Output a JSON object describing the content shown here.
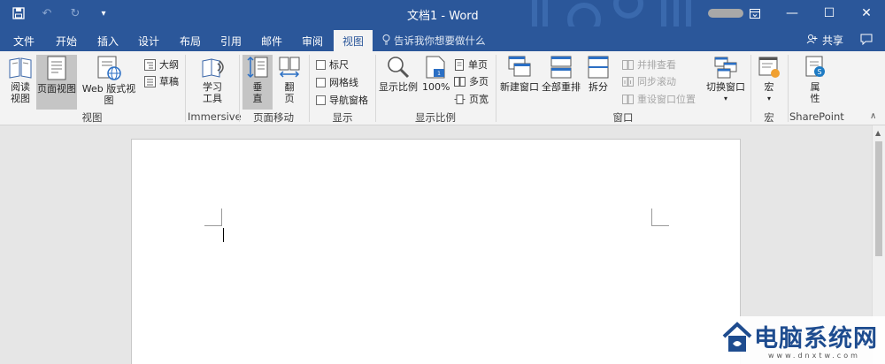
{
  "titlebar": {
    "title": "文档1 - Word",
    "qat": {
      "save_icon": "save-icon",
      "undo_icon": "undo-icon",
      "redo_icon": "redo-icon",
      "customize_icon": "customize-qat-icon"
    },
    "window_controls": [
      "ribbon-display-icon",
      "minimize-icon",
      "restore-icon",
      "close-icon"
    ]
  },
  "tabs": [
    {
      "label": "文件"
    },
    {
      "label": "开始"
    },
    {
      "label": "插入"
    },
    {
      "label": "设计"
    },
    {
      "label": "布局"
    },
    {
      "label": "引用"
    },
    {
      "label": "邮件"
    },
    {
      "label": "审阅"
    },
    {
      "label": "视图",
      "active": true
    }
  ],
  "tellme": {
    "placeholder": "告诉我你想要做什么"
  },
  "share": {
    "label": "共享"
  },
  "ribbon": {
    "views": {
      "label": "视图",
      "read_mode": "阅读\n视图",
      "read_mode_l1": "阅读",
      "read_mode_l2": "视图",
      "print_layout": "页面视图",
      "web_layout": "Web 版式视图",
      "outline": "大纲",
      "draft": "草稿"
    },
    "immersive": {
      "label": "Immersive",
      "learning_tools_l1": "学习",
      "learning_tools_l2": "工具"
    },
    "page_movement": {
      "label": "页面移动",
      "vertical_l1": "垂",
      "vertical_l2": "直",
      "side_l1": "翻",
      "side_l2": "页"
    },
    "show": {
      "label": "显示",
      "ruler": "标尺",
      "gridlines": "网格线",
      "nav_pane": "导航窗格"
    },
    "zoom": {
      "label": "显示比例",
      "zoom": "显示比例",
      "hundred": "100%",
      "one_page": "单页",
      "multi_page": "多页",
      "page_width": "页宽"
    },
    "window": {
      "label": "窗口",
      "new_window": "新建窗口",
      "arrange_all": "全部重排",
      "split": "拆分",
      "side_by_side": "并排查看",
      "sync_scroll": "同步滚动",
      "reset_position": "重设窗口位置",
      "switch_windows": "切换窗口"
    },
    "macros": {
      "label": "宏",
      "macros": "宏"
    },
    "sharepoint": {
      "label": "SharePoint",
      "properties_l1": "属",
      "properties_l2": "性"
    }
  },
  "watermark": {
    "text": "电脑系统网",
    "url": "www.dnxtw.com"
  },
  "colors": {
    "accent": "#2b579a",
    "ribbon_bg": "#f3f3f3",
    "doc_bg": "#e6e6e6"
  }
}
